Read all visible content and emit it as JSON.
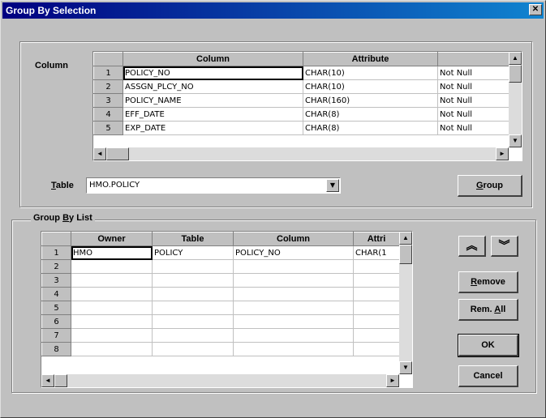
{
  "window": {
    "title": "Group By Selection",
    "close_glyph": "✕"
  },
  "column_section": {
    "label": "Column",
    "headers": [
      "",
      "Column",
      "Attribute",
      ""
    ],
    "rows": [
      {
        "n": "1",
        "column": "POLICY_NO",
        "attribute": "CHAR(10)",
        "nullable": "Not Null"
      },
      {
        "n": "2",
        "column": "ASSGN_PLCY_NO",
        "attribute": "CHAR(10)",
        "nullable": "Not Null"
      },
      {
        "n": "3",
        "column": "POLICY_NAME",
        "attribute": "CHAR(160)",
        "nullable": "Not Null"
      },
      {
        "n": "4",
        "column": "EFF_DATE",
        "attribute": "CHAR(8)",
        "nullable": "Not Null"
      },
      {
        "n": "5",
        "column": "EXP_DATE",
        "attribute": "CHAR(8)",
        "nullable": "Not Null"
      }
    ]
  },
  "table_field": {
    "label_prefix": "T",
    "label_rest": "able",
    "value": "HMO.POLICY"
  },
  "group_button": {
    "prefix": "G",
    "rest": "roup"
  },
  "group_by_section": {
    "label_prefix": "Group ",
    "label_mnemonic": "B",
    "label_rest": "y List",
    "headers": [
      "",
      "Owner",
      "Table",
      "Column",
      "Attri"
    ],
    "rows": [
      {
        "n": "1",
        "owner": "HMO",
        "table": "POLICY",
        "column": "POLICY_NO",
        "attri": "CHAR(1"
      },
      {
        "n": "2",
        "owner": "",
        "table": "",
        "column": "",
        "attri": ""
      },
      {
        "n": "3",
        "owner": "",
        "table": "",
        "column": "",
        "attri": ""
      },
      {
        "n": "4",
        "owner": "",
        "table": "",
        "column": "",
        "attri": ""
      },
      {
        "n": "5",
        "owner": "",
        "table": "",
        "column": "",
        "attri": ""
      },
      {
        "n": "6",
        "owner": "",
        "table": "",
        "column": "",
        "attri": ""
      },
      {
        "n": "7",
        "owner": "",
        "table": "",
        "column": "",
        "attri": ""
      },
      {
        "n": "8",
        "owner": "",
        "table": "",
        "column": "",
        "attri": ""
      }
    ]
  },
  "buttons": {
    "move_up": "︽",
    "move_down": "︾",
    "remove_prefix": "R",
    "remove_rest": "emove",
    "remove_all_prefix": "Rem. ",
    "remove_all_mnemonic": "A",
    "remove_all_rest": "ll",
    "ok": "OK",
    "cancel": "Cancel"
  },
  "icons": {
    "scroll_up": "▲",
    "scroll_down": "▼",
    "scroll_left": "◄",
    "scroll_right": "►",
    "dropdown": "▼"
  }
}
